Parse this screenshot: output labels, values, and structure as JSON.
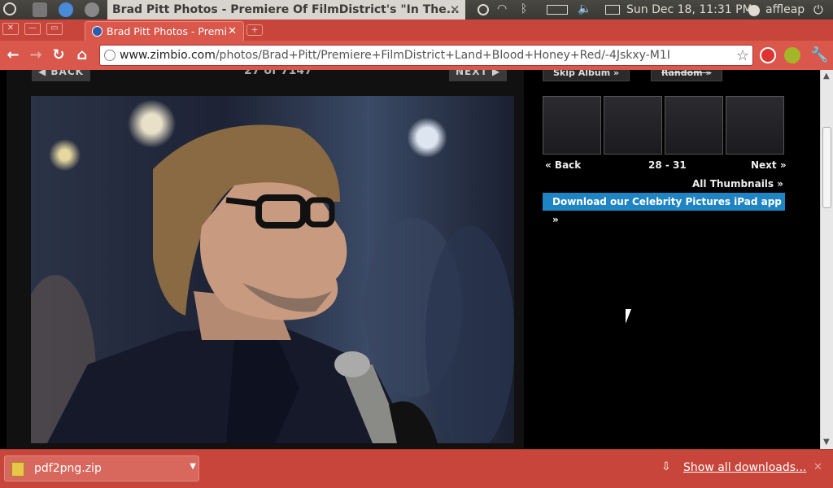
{
  "panel": {
    "window_title": "Brad Pitt Photos - Premiere Of FilmDistrict's \"In The...",
    "datetime": "Sun Dec 18, 11:31 PM",
    "user": "affleap"
  },
  "browser": {
    "tab_title": "Brad Pitt Photos - Premi",
    "url_domain": "www.zimbio.com",
    "url_path": "/photos/Brad+Pitt/Premiere+FilmDistrict+Land+Blood+Honey+Red/-4Jskxy-M1I"
  },
  "gallery": {
    "back_label": "◀ BACK",
    "next_label": "NEXT ▶",
    "counter": "27 of 7147",
    "skip_album": "Skip Album »",
    "random": "Random »",
    "thumb_back": "« Back",
    "thumb_range": "28 - 31",
    "thumb_next": "Next »",
    "all_thumbnails": "All Thumbnails »",
    "ipad_banner": "Download our Celebrity Pictures iPad app »"
  },
  "downloads": {
    "file_name": "pdf2png.zip",
    "show_all": "Show all downloads..."
  }
}
